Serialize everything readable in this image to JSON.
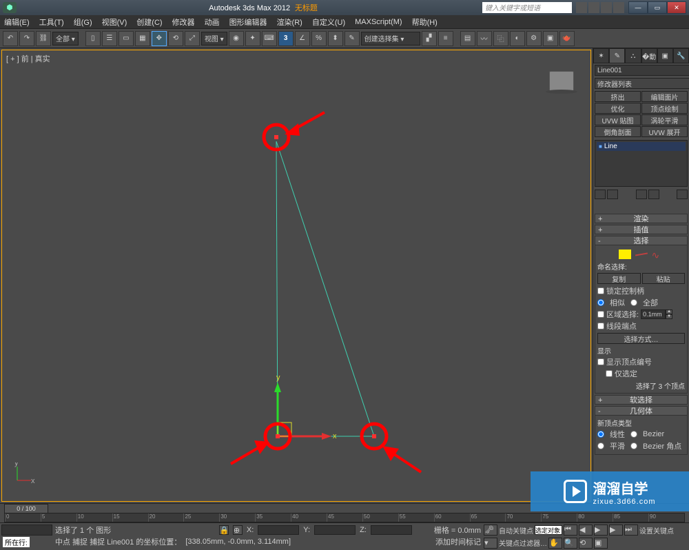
{
  "title": {
    "app": "Autodesk 3ds Max 2012",
    "untitled": "无标题",
    "search_placeholder": "键入关键字或短语"
  },
  "menu": [
    "编辑(E)",
    "工具(T)",
    "组(G)",
    "视图(V)",
    "创建(C)",
    "修改器",
    "动画",
    "图形编辑器",
    "渲染(R)",
    "自定义(U)",
    "MAXScript(M)",
    "帮助(H)"
  ],
  "toolbar": {
    "all_dropdown": "全部 ▾",
    "view_dropdown": "视图 ▾",
    "snap3": "3",
    "selset_dropdown": "创建选择集 ▾"
  },
  "viewport": {
    "label": "[ + ] 前 | 真实"
  },
  "panel": {
    "object_name": "Line001",
    "mod_list_label": "修改器列表",
    "mod_buttons": [
      "挤出",
      "编辑面片",
      "优化",
      "顶点绘制",
      "UVW 贴图",
      "涡轮平滑",
      "倒角剖面",
      "UVW 展开"
    ],
    "stack_item": "Line",
    "rollouts": {
      "render": "渲染",
      "interp": "插值",
      "selection": "选择",
      "softsel": "软选择",
      "geometry": "几何体"
    },
    "sel": {
      "named_label": "命名选择:",
      "copy": "复制",
      "paste": "粘贴",
      "lock_handles": "锁定控制柄",
      "alike": "相似",
      "all": "全部",
      "area_select": "区域选择:",
      "area_value": "0.1mm",
      "seg_end": "线段端点",
      "select_by": "选择方式…",
      "display": "显示",
      "show_vnum": "显示顶点编号",
      "only_sel": "仅选定",
      "status": "选择了 3 个顶点"
    },
    "geom": {
      "new_vtype": "新顶点类型",
      "linear": "线性",
      "bezier": "Bezier",
      "smooth": "平滑",
      "bezier_corner": "Bezier 角点"
    }
  },
  "timeline": {
    "slider": "0 / 100",
    "ticks": [
      "0",
      "5",
      "10",
      "15",
      "20",
      "25",
      "30",
      "35",
      "40",
      "45",
      "50",
      "55",
      "60",
      "65",
      "70",
      "75",
      "80",
      "85",
      "90"
    ]
  },
  "status": {
    "loc_label": "所在行:",
    "sel_info": "选择了 1 个 图形",
    "snap_info": "中点 捕捉 捕捉 Line001 的坐标位置：",
    "coords_raw": "[338.05mm, -0.0mm, 3.114mm]",
    "x": "X:",
    "y": "Y:",
    "z": "Z:",
    "grid": "栅格 = 0.0mm",
    "autokey": "自动关键点",
    "selset": "选定对象",
    "setkey": "设置关键点",
    "keyfilter": "关键点过滤器…",
    "add_time": "添加时间标记"
  },
  "watermark": {
    "big": "溜溜自学",
    "small": "zixue.3d66.com"
  },
  "annotation": {
    "vertices_highlighted": 3,
    "shape": "triangle-line",
    "gizmo_axes": [
      "x",
      "y"
    ]
  }
}
